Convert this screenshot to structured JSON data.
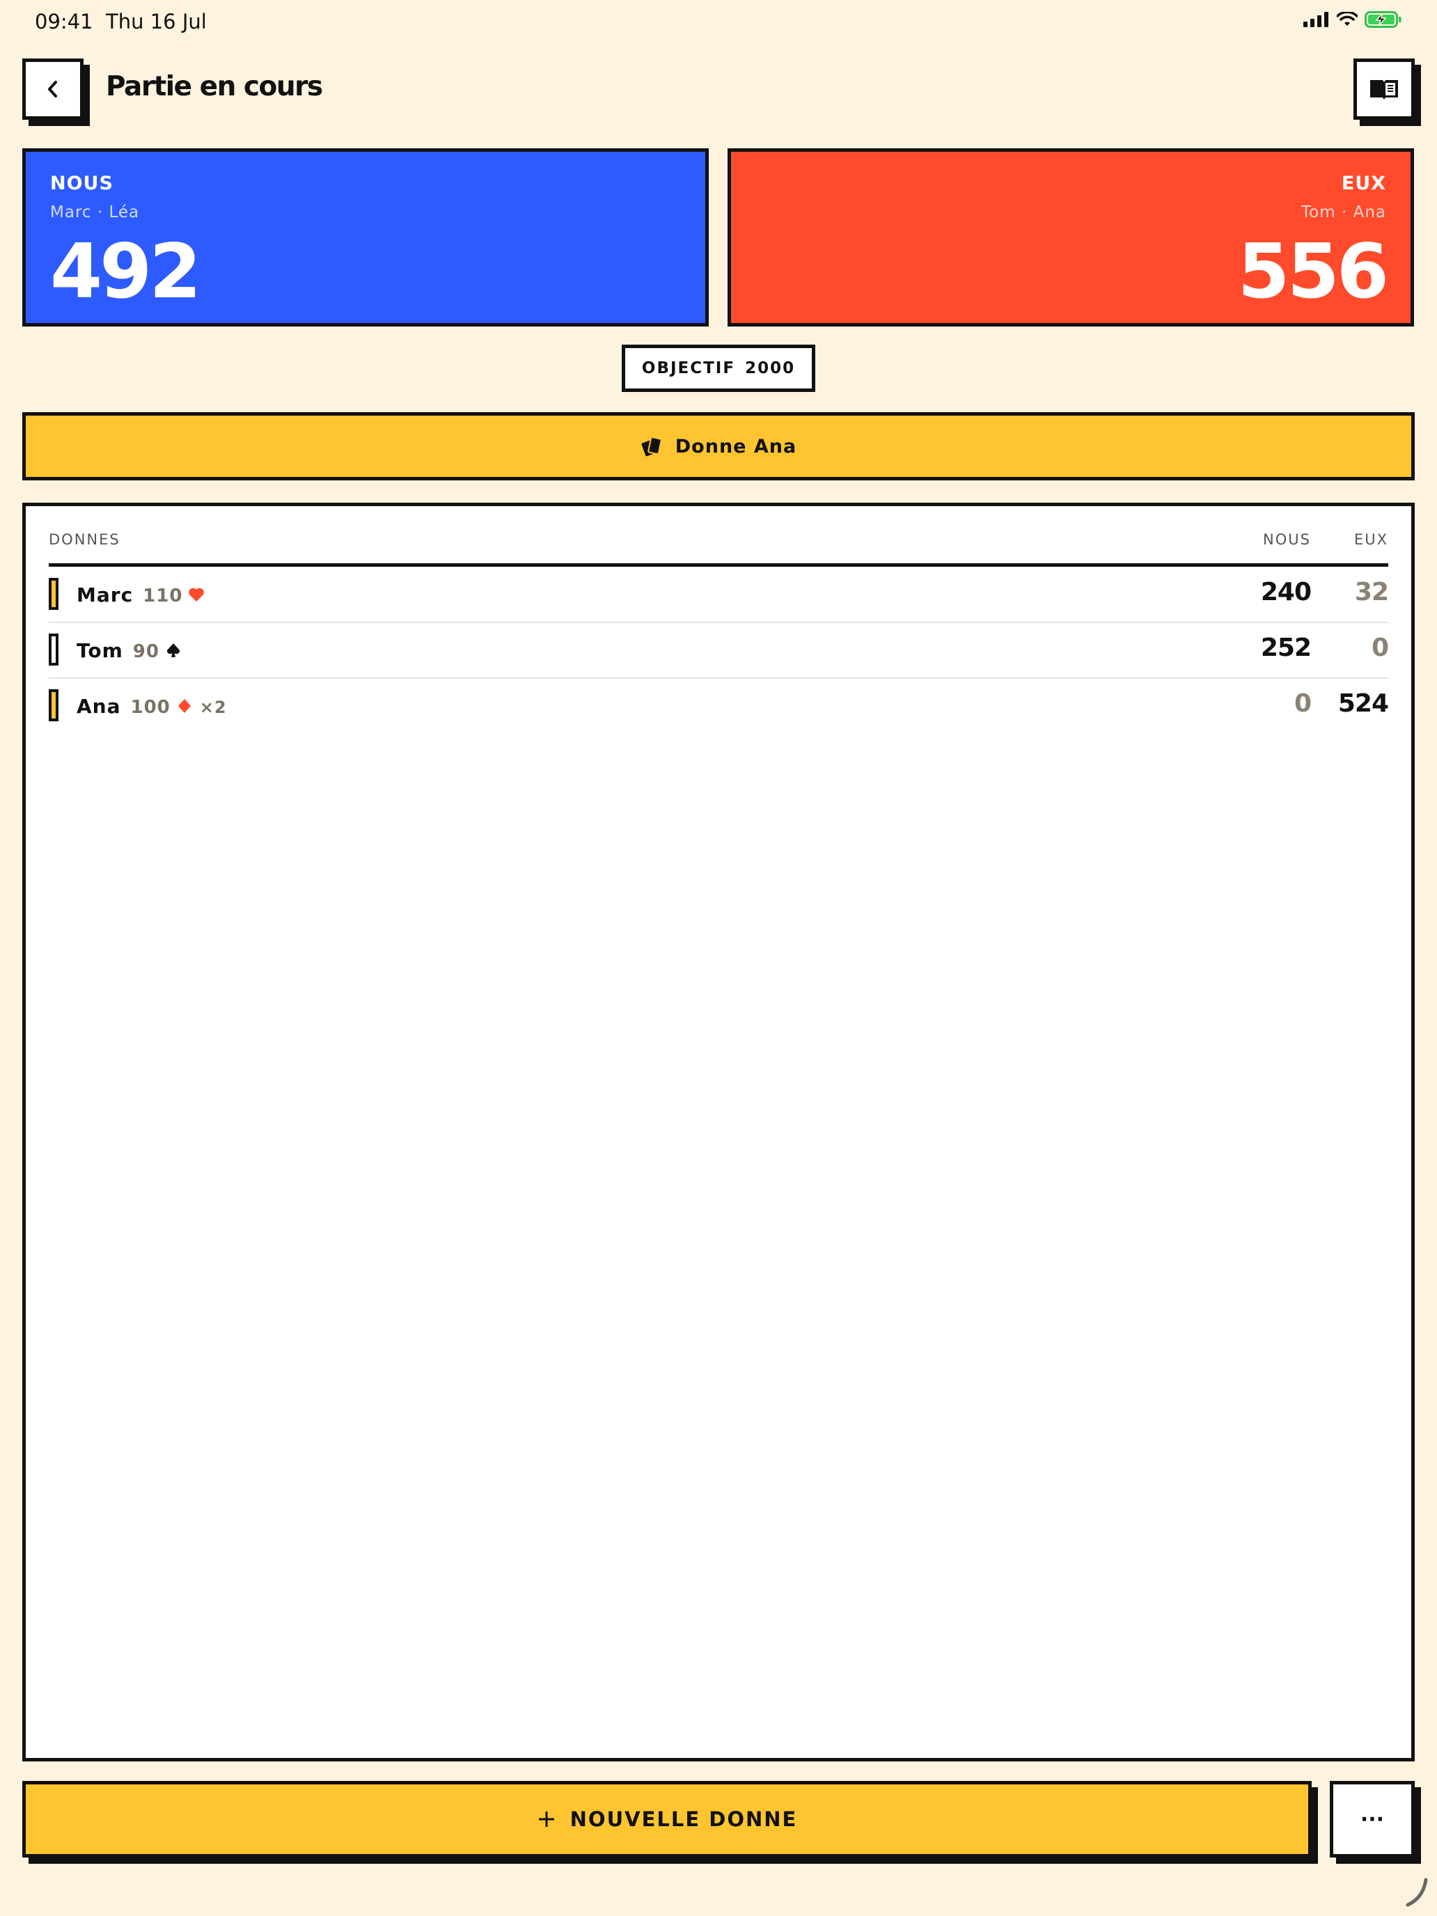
{
  "status_bar": {
    "time": "09:41",
    "date": "Thu 16 Jul"
  },
  "header": {
    "title": "Partie en cours",
    "back_icon": "chevron-left-icon",
    "rules_icon": "book-icon"
  },
  "teams": {
    "nous": {
      "label": "NOUS",
      "players": "Marc · Léa",
      "score": "492",
      "color": "#2E5BFF"
    },
    "eux": {
      "label": "EUX",
      "players": "Tom · Ana",
      "score": "556",
      "color": "#FF4A2B"
    }
  },
  "objective": {
    "label": "OBJECTIF",
    "value": "2000"
  },
  "dealer": {
    "text": "Donne Ana",
    "icon": "cards-icon"
  },
  "table": {
    "headers": {
      "donnes": "DONNES",
      "nous": "NOUS",
      "eux": "EUX"
    },
    "rows": [
      {
        "player": "Marc",
        "bid": "110",
        "suit": "heart",
        "multiplier": "",
        "nous": "240",
        "eux": "32",
        "winner": "nous",
        "marker": "filled"
      },
      {
        "player": "Tom",
        "bid": "90",
        "suit": "spade",
        "multiplier": "",
        "nous": "252",
        "eux": "0",
        "winner": "nous",
        "marker": "outline"
      },
      {
        "player": "Ana",
        "bid": "100",
        "suit": "diamond",
        "multiplier": "×2",
        "nous": "0",
        "eux": "524",
        "winner": "eux",
        "marker": "filled"
      }
    ]
  },
  "actions": {
    "new_deal_label": "NOUVELLE DONNE",
    "new_deal_icon": "plus-icon",
    "more_label": "···"
  },
  "colors": {
    "background": "#FEF3DF",
    "accent_yellow": "#FFC530",
    "ink": "#111111",
    "heart": "#FF4A2B"
  }
}
